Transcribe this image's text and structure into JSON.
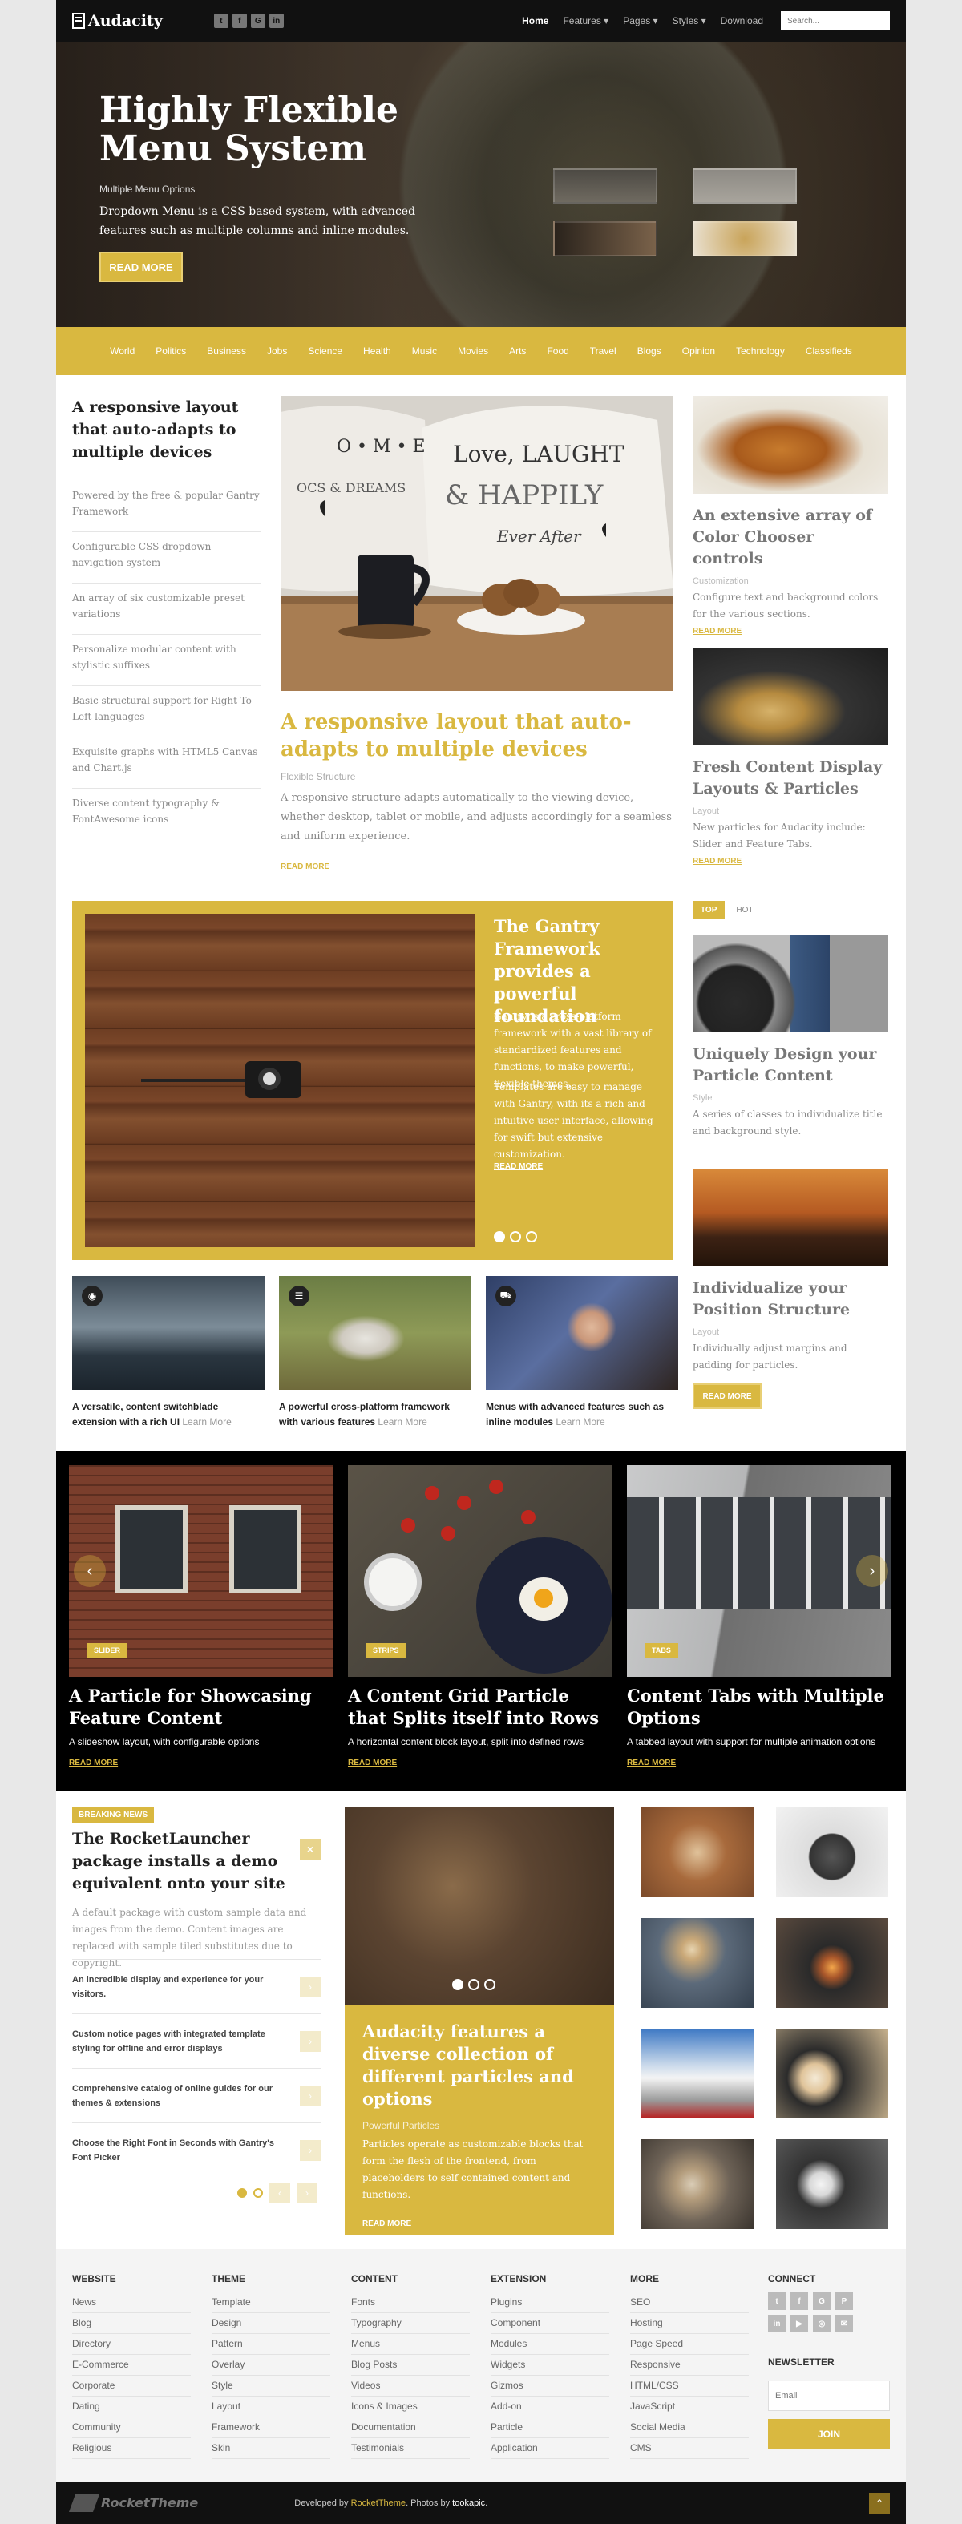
{
  "header": {
    "logo": "Audacity",
    "social": [
      "t",
      "f",
      "G",
      "in"
    ],
    "nav": [
      "Home",
      "Features ▾",
      "Pages ▾",
      "Styles ▾",
      "Download"
    ],
    "search_placeholder": "Search..."
  },
  "hero": {
    "title": "Highly Flexible Menu System",
    "subtitle": "Multiple Menu Options",
    "description": "Dropdown Menu is a CSS based system, with advanced features such as multiple columns and inline modules.",
    "button": "READ MORE"
  },
  "categories": [
    "World",
    "Politics",
    "Business",
    "Jobs",
    "Science",
    "Health",
    "Music",
    "Movies",
    "Arts",
    "Food",
    "Travel",
    "Blogs",
    "Opinion",
    "Technology",
    "Classifieds"
  ],
  "left_column": {
    "title": "A responsive layout that auto-adapts to multiple devices",
    "items": [
      "Powered by the free & popular Gantry Framework",
      "Configurable CSS dropdown navigation system",
      "An array of six customizable preset variations",
      "Personalize modular content with stylistic suffixes",
      "Basic structural support for Right-To-Left languages",
      "Exquisite graphs with HTML5 Canvas and Chart.js",
      "Diverse content typography & FontAwesome icons"
    ]
  },
  "center_article": {
    "pillow_left": "H O • M • E\nIS MADE FROM\nMEMORIES & DREAMS",
    "pillow_right": "Love, LAUGHTER\n& HAPPILY\nEver After",
    "title": "A responsive layout that auto-adapts to multiple devices",
    "category": "Flexible Structure",
    "text": "A responsive structure adapts automatically to the viewing device, whether desktop, tablet or mobile, and adjusts accordingly for a seamless and uniform experience.",
    "read_more": "READ MORE"
  },
  "right_cards": [
    {
      "title": "An extensive array of Color Chooser controls",
      "category": "Customization",
      "text": "Configure text and background colors for the various sections.",
      "read_more": "READ MORE"
    },
    {
      "title": "Fresh Content Display Layouts & Particles",
      "category": "Layout",
      "text": "New particles for Audacity include: Slider and Feature Tabs.",
      "read_more": "READ MORE"
    }
  ],
  "gold_feature": {
    "title": "The Gantry Framework provides a powerful foundation",
    "p1": "Gantry is a cross-platform framework with a vast library of standardized features and functions, to make powerful, flexible themes.",
    "p2": "Templates are easy to manage with Gantry, with its a rich and intuitive user interface, allowing for swift but extensive customization.",
    "read_more": "READ MORE"
  },
  "tabs": [
    "TOP",
    "HOT"
  ],
  "tab_cards": [
    {
      "title": "Uniquely Design your Particle Content",
      "category": "Style",
      "text": "A series of classes to individualize title and background style."
    },
    {
      "title": "Individualize your Position Structure",
      "category": "Layout",
      "text": "Individually adjust margins and padding for particles.",
      "button": "READ MORE"
    }
  ],
  "mini_cards": [
    {
      "text": "A versatile, content switchblade extension with a rich UI",
      "link": "Learn More"
    },
    {
      "text": "A powerful cross-platform framework with various features",
      "link": "Learn More"
    },
    {
      "text": "Menus with advanced features such as inline modules",
      "link": "Learn More"
    }
  ],
  "band_cards": [
    {
      "tag": "SLIDER",
      "title": "A Particle for Showcasing Feature Content",
      "text": "A slideshow layout, with configurable options",
      "read_more": "READ MORE"
    },
    {
      "tag": "STRIPS",
      "title": "A Content Grid Particle that Splits itself into Rows",
      "text": "A horizontal content block layout, split into defined rows",
      "read_more": "READ MORE"
    },
    {
      "tag": "TABS",
      "title": "Content Tabs with Multiple Options",
      "text": "A tabbed layout with support for multiple animation options",
      "read_more": "READ MORE"
    }
  ],
  "breaking_news": {
    "tag": "BREAKING NEWS",
    "title": "The RocketLauncher package installs a demo equivalent onto your site",
    "text": "A default package with custom sample data and images from the demo. Content images are replaced with sample tiled substitutes due to copyright.",
    "items": [
      "An incredible display and experience for your visitors.",
      "Custom notice pages with integrated template styling for offline and error displays",
      "Comprehensive catalog of online guides for our themes & extensions",
      "Choose the Right Font in Seconds with Gantry's Font Picker"
    ]
  },
  "feature_column": {
    "title": "Audacity features a diverse collection of different particles and options",
    "category": "Powerful Particles",
    "text": "Particles operate as customizable blocks that form the flesh of the frontend, from placeholders to self contained content and functions.",
    "read_more": "READ MORE"
  },
  "footer": {
    "columns": [
      {
        "title": "WEBSITE",
        "links": [
          "News",
          "Blog",
          "Directory",
          "E-Commerce",
          "Corporate",
          "Dating",
          "Community",
          "Religious"
        ]
      },
      {
        "title": "THEME",
        "links": [
          "Template",
          "Design",
          "Pattern",
          "Overlay",
          "Style",
          "Layout",
          "Framework",
          "Skin"
        ]
      },
      {
        "title": "CONTENT",
        "links": [
          "Fonts",
          "Typography",
          "Menus",
          "Blog Posts",
          "Videos",
          "Icons & Images",
          "Documentation",
          "Testimonials"
        ]
      },
      {
        "title": "EXTENSION",
        "links": [
          "Plugins",
          "Component",
          "Modules",
          "Widgets",
          "Gizmos",
          "Add-on",
          "Particle",
          "Application"
        ]
      },
      {
        "title": "MORE",
        "links": [
          "SEO",
          "Hosting",
          "Page Speed",
          "Responsive",
          "HTML/CSS",
          "JavaScript",
          "Social Media",
          "CMS"
        ]
      }
    ],
    "connect_title": "CONNECT",
    "connect_icons": [
      "t",
      "f",
      "G",
      "P",
      "in",
      "▶",
      "◎",
      "✉"
    ],
    "newsletter_title": "NEWSLETTER",
    "email_placeholder": "Email",
    "join": "JOIN"
  },
  "copyright": {
    "logo": "RocketTheme",
    "developed": "Developed by ",
    "brand": "RocketTheme",
    "photos": ". Photos by ",
    "photographer": "tookapic",
    "end": "."
  },
  "colors": {
    "accent": "#d9b840",
    "dark": "#111111"
  }
}
